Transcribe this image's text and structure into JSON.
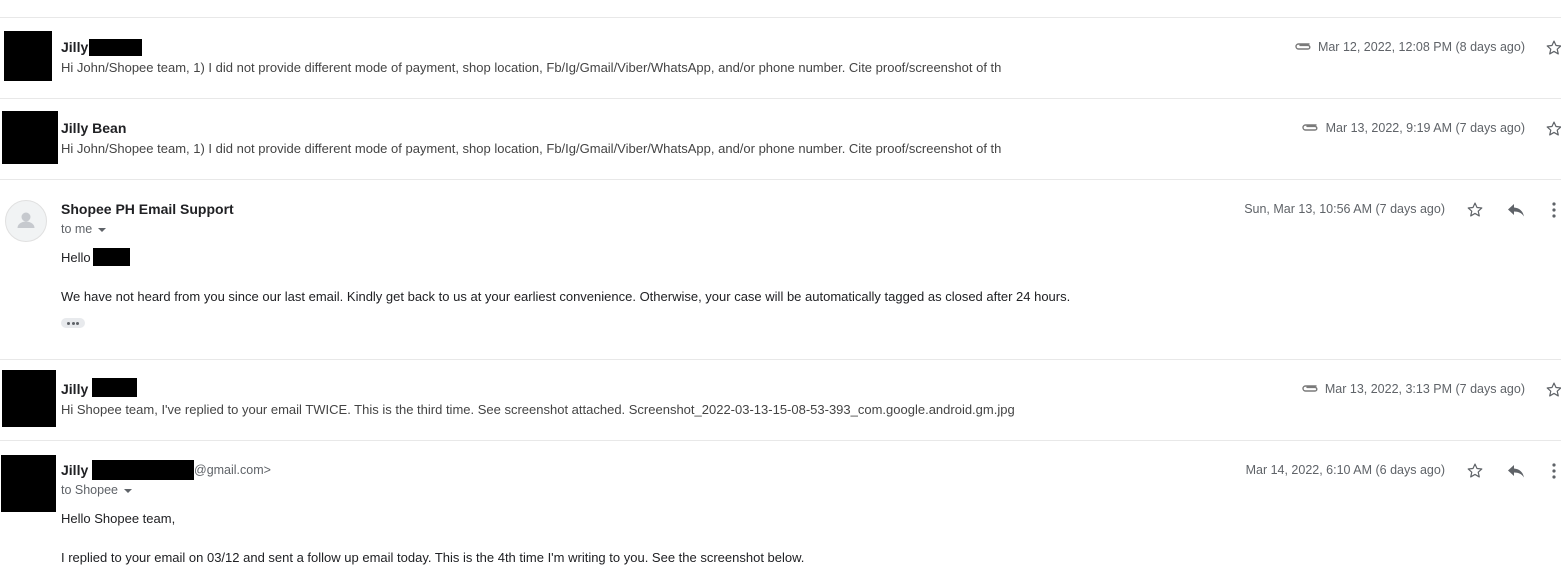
{
  "messages": [
    {
      "sender": "Jilly",
      "snippet": "Hi John/Shopee team, 1) I did not provide different mode of payment, shop location, Fb/Ig/Gmail/Viber/WhatsApp, and/or phone number. Cite proof/screenshot of th",
      "date": "Mar 12, 2022, 12:08 PM (8 days ago)",
      "has_attachment": true
    },
    {
      "sender": "Jilly Bean",
      "snippet": "Hi John/Shopee team, 1) I did not provide different mode of payment, shop location, Fb/Ig/Gmail/Viber/WhatsApp, and/or phone number. Cite proof/screenshot of th",
      "date": "Mar 13, 2022, 9:19 AM (7 days ago)",
      "has_attachment": true
    },
    {
      "sender": "Shopee PH Email Support",
      "recipient": "to me",
      "date": "Sun, Mar 13, 10:56 AM (7 days ago)",
      "greeting": "Hello",
      "body": "We have not heard from you since our last email. Kindly get back to us at your earliest convenience. Otherwise, your case will be automatically tagged as closed after 24 hours."
    },
    {
      "sender": "Jilly",
      "snippet": "Hi Shopee team, I've replied to your email TWICE. This is the third time. See screenshot attached. Screenshot_2022-03-13-15-08-53-393_com.google.android.gm.jpg",
      "date": "Mar 13, 2022, 3:13 PM (7 days ago)",
      "has_attachment": true
    },
    {
      "sender": "Jilly",
      "sender_email_suffix": "@gmail.com>",
      "recipient": "to Shopee",
      "date": "Mar 14, 2022, 6:10 AM (6 days ago)",
      "greeting": "Hello Shopee team,",
      "body": "I replied to your email on 03/12 and sent a follow up email today. This is the 4th time I'm writing to you. See the screenshot below."
    }
  ],
  "icons": {
    "attachment": "paperclip-icon",
    "star": "star-icon",
    "reply": "reply-icon",
    "more": "more-vert-icon",
    "avatar": "default-avatar-icon"
  }
}
